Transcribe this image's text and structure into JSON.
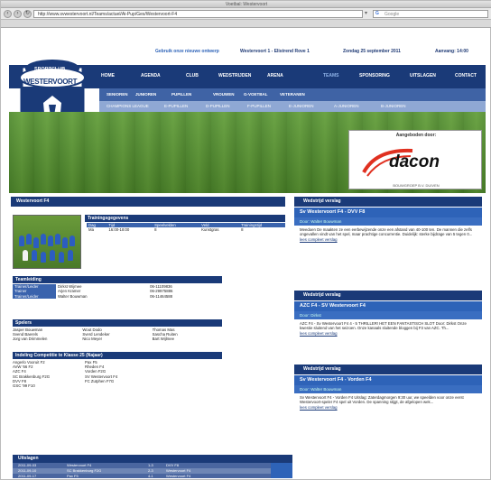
{
  "browser": {
    "title": "Voetbal: Westervoort",
    "url": "http://www.svwestervoort.nl/Teams/actuel/Ai-Pup/Ges/Westervoort-F4",
    "search_placeholder": "Google",
    "bookmarks": [
      "Bezoeker en beste dans",
      "Sport/Info p",
      "Agil-Dashing",
      "Handelsbedrijven",
      "PBM Indsling",
      "Thuiswedden",
      "Plaatsen en ook te",
      "Spannender Voor hosting",
      "Agility",
      "Hemel",
      "Voorinfo"
    ]
  },
  "header": {
    "top_left": "Gebruik onze nieuwe ontwerp",
    "match_info": "Westervoort 1 - Elistrend Rove 1",
    "date": "Zondag 25 september 2011",
    "time": "Aanvang: 14:00"
  },
  "logo": {
    "top": "SPORTCLUB",
    "name": "WESTERVOORT"
  },
  "main_nav": [
    "HOME",
    "AGENDA",
    "CLUB",
    "WEDSTRIJDEN",
    "ARENA",
    "TEAMS",
    "SPONSORING",
    "UITSLAGEN",
    "CONTACT"
  ],
  "sub_nav": [
    "SENIOREN",
    "JUNIOREN",
    "PUPILLEN",
    "VROUWEN",
    "G-VOETBAL",
    "VETERANEN"
  ],
  "sub_nav2": [
    "CHAMPIONS LEAGUE",
    "E-PUPILLEN",
    "D-PUPILLEN",
    "F-PUPILLEN",
    "E-JUNIOREN",
    "A-JUNIOREN",
    "B-JUNIOREN"
  ],
  "sponsor": {
    "label": "Aangeboden door:",
    "name": "dacon",
    "tagline": "BOUWGROEP B.V. DUIVEN"
  },
  "team": {
    "title": "Westervoort F4",
    "training_header": "Trainingsgegevens",
    "training_cols": [
      "Dag",
      "Tijd",
      "Speelvelden",
      "Veld",
      "Trainingstijd"
    ],
    "training_row": [
      "Ma",
      "16:00-18:00",
      "8",
      "Kunstgras",
      "8"
    ],
    "staff_header": "Teamleiding",
    "staff": [
      {
        "role": "Trainer/Leider",
        "name": "Dirkst Wijmee",
        "phone": "06-11109836"
      },
      {
        "role": "Trainer",
        "name": "Arjen Kramer",
        "phone": "06-29975886"
      },
      {
        "role": "Trainer/Leider",
        "name": "Walter Bouwman",
        "phone": "06-11464588"
      }
    ],
    "players_header": "Spelers",
    "players": [
      [
        "Jasper Bouwman",
        "Wout Dodo",
        "Thomas Mas"
      ],
      [
        "Svend Baerels",
        "Sverd Lendeker",
        "Sascha Ruiten"
      ],
      [
        "Jorg van Drimmelen",
        "Nico Meyer",
        "Bart Wijlmee"
      ]
    ],
    "competition_header": "Indeling Competitie te Klasse 25 (Najaar)",
    "competition": [
      [
        "Angerlo Vooruit F2",
        "Pax F5"
      ],
      [
        "AVW '66 F2",
        "Rheden F4"
      ],
      [
        "AZC F4",
        "Vorden F2G"
      ],
      [
        "SC Brakkenburg F2G",
        "SV Westervoort F4"
      ],
      [
        "DVV F8",
        "FC Zutphen F7G"
      ],
      [
        "GSC '99 F10",
        ""
      ]
    ],
    "results_header": "Uitslagen",
    "results": [
      [
        "2011-09-03",
        "Westervoort F4",
        "1-3",
        "DVV F8"
      ],
      [
        "2011-09-10",
        "SC Brakkenburg F2G",
        "2-3",
        "Westervoort F4"
      ],
      [
        "2011-09-17",
        "Pax F5",
        "4-1",
        "Westervoort F4"
      ]
    ]
  },
  "reports": [
    {
      "header": "Wedstrijd verslag",
      "match": "Sv Westervoort F4 - DVV F8",
      "author": "Door: Walter Bouwman",
      "text": "Meedoen De maakten ze een eerbewijzende onze een afstand van 40-100 ten. De mannen die zelfs ongevallen vindt van het spel, maar prachtige concurrentie. Duidelijk: sterke bijdrage van 5 tegen 0...",
      "more": "lees compleet verslag"
    },
    {
      "header": "Wedstrijd verslag",
      "match": "AZC F4 - SV Westervoort F4",
      "author": "Door: Dirkst",
      "text": "AZC F4 - Sv Westervoort F4 4 - 5 THRILLER! HET EEN FANTASTISCH SLOT Door: Dirkst Onze kwestie sluitend van het seizoen. Onze kanaals sluitende bloggen bij F3 van AZC. Th...",
      "more": "lees compleet verslag"
    },
    {
      "header": "Wedstrijd verslag",
      "match": "Sv Westervoort F4 - Vorden F4",
      "author": "Door: Walter Bouwman",
      "text": "Sv Westervoort F4 - Vorden F4 Uitslag: Zaterdagmorgen 9:30 uur, we speelden voor onze eerst Westervoort-speler F4 spel uit Vorden. De spanning stijgt, de afgelopen wek...",
      "more": "lees compleet verslag"
    }
  ],
  "colors": {
    "nav": "#1a3a78",
    "accent": "#2e63b8",
    "active": "#8fb3e8"
  }
}
